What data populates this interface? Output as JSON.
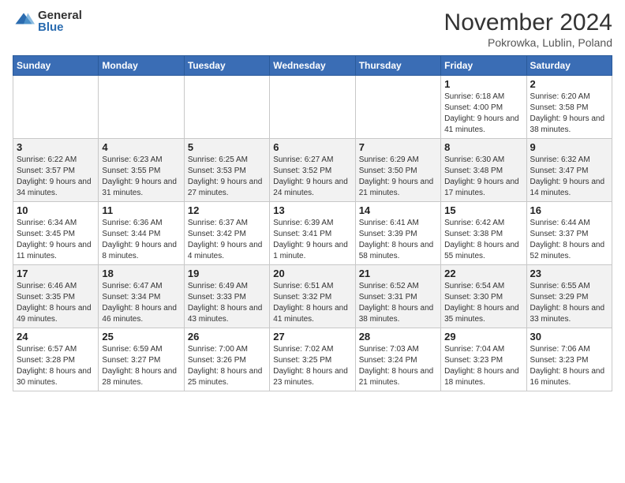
{
  "header": {
    "logo_general": "General",
    "logo_blue": "Blue",
    "month_title": "November 2024",
    "subtitle": "Pokrowka, Lublin, Poland"
  },
  "days_of_week": [
    "Sunday",
    "Monday",
    "Tuesday",
    "Wednesday",
    "Thursday",
    "Friday",
    "Saturday"
  ],
  "weeks": [
    [
      {
        "day": "",
        "info": ""
      },
      {
        "day": "",
        "info": ""
      },
      {
        "day": "",
        "info": ""
      },
      {
        "day": "",
        "info": ""
      },
      {
        "day": "",
        "info": ""
      },
      {
        "day": "1",
        "info": "Sunrise: 6:18 AM\nSunset: 4:00 PM\nDaylight: 9 hours and 41 minutes."
      },
      {
        "day": "2",
        "info": "Sunrise: 6:20 AM\nSunset: 3:58 PM\nDaylight: 9 hours and 38 minutes."
      }
    ],
    [
      {
        "day": "3",
        "info": "Sunrise: 6:22 AM\nSunset: 3:57 PM\nDaylight: 9 hours and 34 minutes."
      },
      {
        "day": "4",
        "info": "Sunrise: 6:23 AM\nSunset: 3:55 PM\nDaylight: 9 hours and 31 minutes."
      },
      {
        "day": "5",
        "info": "Sunrise: 6:25 AM\nSunset: 3:53 PM\nDaylight: 9 hours and 27 minutes."
      },
      {
        "day": "6",
        "info": "Sunrise: 6:27 AM\nSunset: 3:52 PM\nDaylight: 9 hours and 24 minutes."
      },
      {
        "day": "7",
        "info": "Sunrise: 6:29 AM\nSunset: 3:50 PM\nDaylight: 9 hours and 21 minutes."
      },
      {
        "day": "8",
        "info": "Sunrise: 6:30 AM\nSunset: 3:48 PM\nDaylight: 9 hours and 17 minutes."
      },
      {
        "day": "9",
        "info": "Sunrise: 6:32 AM\nSunset: 3:47 PM\nDaylight: 9 hours and 14 minutes."
      }
    ],
    [
      {
        "day": "10",
        "info": "Sunrise: 6:34 AM\nSunset: 3:45 PM\nDaylight: 9 hours and 11 minutes."
      },
      {
        "day": "11",
        "info": "Sunrise: 6:36 AM\nSunset: 3:44 PM\nDaylight: 9 hours and 8 minutes."
      },
      {
        "day": "12",
        "info": "Sunrise: 6:37 AM\nSunset: 3:42 PM\nDaylight: 9 hours and 4 minutes."
      },
      {
        "day": "13",
        "info": "Sunrise: 6:39 AM\nSunset: 3:41 PM\nDaylight: 9 hours and 1 minute."
      },
      {
        "day": "14",
        "info": "Sunrise: 6:41 AM\nSunset: 3:39 PM\nDaylight: 8 hours and 58 minutes."
      },
      {
        "day": "15",
        "info": "Sunrise: 6:42 AM\nSunset: 3:38 PM\nDaylight: 8 hours and 55 minutes."
      },
      {
        "day": "16",
        "info": "Sunrise: 6:44 AM\nSunset: 3:37 PM\nDaylight: 8 hours and 52 minutes."
      }
    ],
    [
      {
        "day": "17",
        "info": "Sunrise: 6:46 AM\nSunset: 3:35 PM\nDaylight: 8 hours and 49 minutes."
      },
      {
        "day": "18",
        "info": "Sunrise: 6:47 AM\nSunset: 3:34 PM\nDaylight: 8 hours and 46 minutes."
      },
      {
        "day": "19",
        "info": "Sunrise: 6:49 AM\nSunset: 3:33 PM\nDaylight: 8 hours and 43 minutes."
      },
      {
        "day": "20",
        "info": "Sunrise: 6:51 AM\nSunset: 3:32 PM\nDaylight: 8 hours and 41 minutes."
      },
      {
        "day": "21",
        "info": "Sunrise: 6:52 AM\nSunset: 3:31 PM\nDaylight: 8 hours and 38 minutes."
      },
      {
        "day": "22",
        "info": "Sunrise: 6:54 AM\nSunset: 3:30 PM\nDaylight: 8 hours and 35 minutes."
      },
      {
        "day": "23",
        "info": "Sunrise: 6:55 AM\nSunset: 3:29 PM\nDaylight: 8 hours and 33 minutes."
      }
    ],
    [
      {
        "day": "24",
        "info": "Sunrise: 6:57 AM\nSunset: 3:28 PM\nDaylight: 8 hours and 30 minutes."
      },
      {
        "day": "25",
        "info": "Sunrise: 6:59 AM\nSunset: 3:27 PM\nDaylight: 8 hours and 28 minutes."
      },
      {
        "day": "26",
        "info": "Sunrise: 7:00 AM\nSunset: 3:26 PM\nDaylight: 8 hours and 25 minutes."
      },
      {
        "day": "27",
        "info": "Sunrise: 7:02 AM\nSunset: 3:25 PM\nDaylight: 8 hours and 23 minutes."
      },
      {
        "day": "28",
        "info": "Sunrise: 7:03 AM\nSunset: 3:24 PM\nDaylight: 8 hours and 21 minutes."
      },
      {
        "day": "29",
        "info": "Sunrise: 7:04 AM\nSunset: 3:23 PM\nDaylight: 8 hours and 18 minutes."
      },
      {
        "day": "30",
        "info": "Sunrise: 7:06 AM\nSunset: 3:23 PM\nDaylight: 8 hours and 16 minutes."
      }
    ]
  ]
}
